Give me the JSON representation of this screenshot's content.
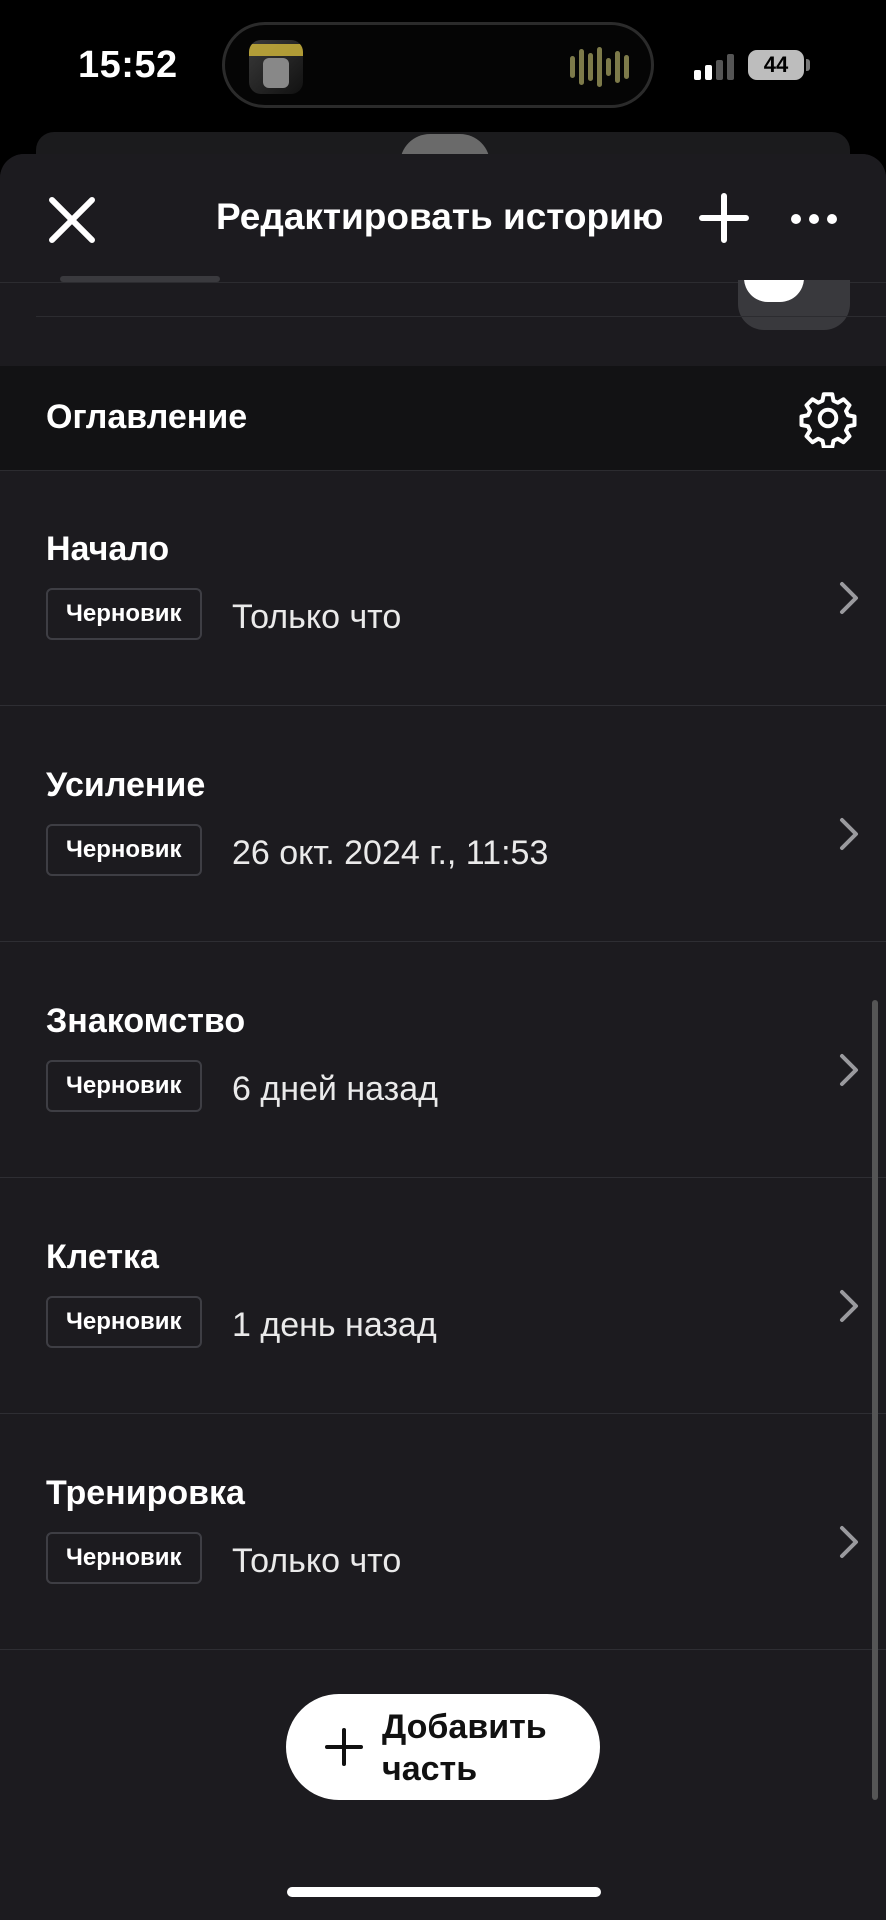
{
  "status_bar": {
    "time": "15:52",
    "battery": "44",
    "cellular_icon": "signal-bars-icon"
  },
  "nav": {
    "title": "Редактировать историю",
    "close_icon": "close-icon",
    "add_icon": "plus-icon",
    "more_icon": "more-icon"
  },
  "toc": {
    "title": "Оглавление",
    "settings_icon": "gear-icon"
  },
  "parts": [
    {
      "title": "Начало",
      "status": "Черновик",
      "updated": "Только что"
    },
    {
      "title": "Усиление",
      "status": "Черновик",
      "updated": "26 окт. 2024 г., 11:53"
    },
    {
      "title": "Знакомство",
      "status": "Черновик",
      "updated": "6 дней назад"
    },
    {
      "title": "Клетка",
      "status": "Черновик",
      "updated": "1 день назад"
    },
    {
      "title": "Тренировка",
      "status": "Черновик",
      "updated": "Только что"
    }
  ],
  "add_part_button": {
    "label": "Добавить часть"
  },
  "colors": {
    "background": "#000000",
    "sheet": "#1c1b1f",
    "section_header": "#121214",
    "divider": "#2e2e33",
    "text": "#ffffff",
    "button_bg": "#ffffff"
  }
}
